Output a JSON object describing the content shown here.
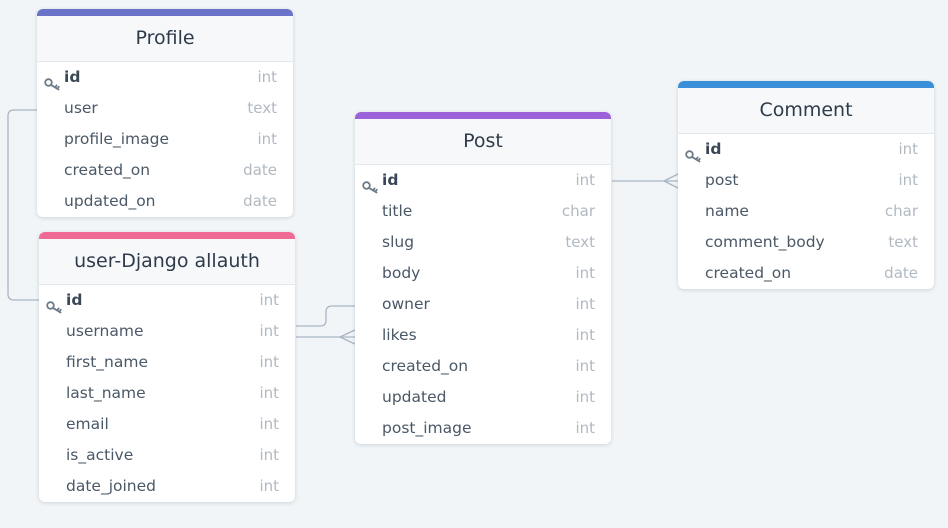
{
  "colors": {
    "profile": "#6b73c9",
    "user": "#ef6a95",
    "post": "#9b62d9",
    "comment": "#3b8fd8",
    "connector": "#a9b6c4"
  },
  "tables": {
    "profile": {
      "title": "Profile",
      "fields": [
        {
          "name": "id",
          "type": "int",
          "pk": true
        },
        {
          "name": "user",
          "type": "text"
        },
        {
          "name": "profile_image",
          "type": "int"
        },
        {
          "name": "created_on",
          "type": "date"
        },
        {
          "name": "updated_on",
          "type": "date"
        }
      ]
    },
    "user": {
      "title": "user-Django allauth",
      "fields": [
        {
          "name": "id",
          "type": "int",
          "pk": true
        },
        {
          "name": "username",
          "type": "int"
        },
        {
          "name": "first_name",
          "type": "int"
        },
        {
          "name": "last_name",
          "type": "int"
        },
        {
          "name": "email",
          "type": "int"
        },
        {
          "name": "is_active",
          "type": "int"
        },
        {
          "name": "date_joined",
          "type": "int"
        }
      ]
    },
    "post": {
      "title": "Post",
      "fields": [
        {
          "name": "id",
          "type": "int",
          "pk": true
        },
        {
          "name": "title",
          "type": "char"
        },
        {
          "name": "slug",
          "type": "text"
        },
        {
          "name": "body",
          "type": "int"
        },
        {
          "name": "owner",
          "type": "int"
        },
        {
          "name": "likes",
          "type": "int"
        },
        {
          "name": "created_on",
          "type": "int"
        },
        {
          "name": "updated",
          "type": "int"
        },
        {
          "name": "post_image",
          "type": "int"
        }
      ]
    },
    "comment": {
      "title": "Comment",
      "fields": [
        {
          "name": "id",
          "type": "int",
          "pk": true
        },
        {
          "name": "post",
          "type": "int"
        },
        {
          "name": "name",
          "type": "char"
        },
        {
          "name": "comment_body",
          "type": "text"
        },
        {
          "name": "created_on",
          "type": "date"
        }
      ]
    }
  }
}
